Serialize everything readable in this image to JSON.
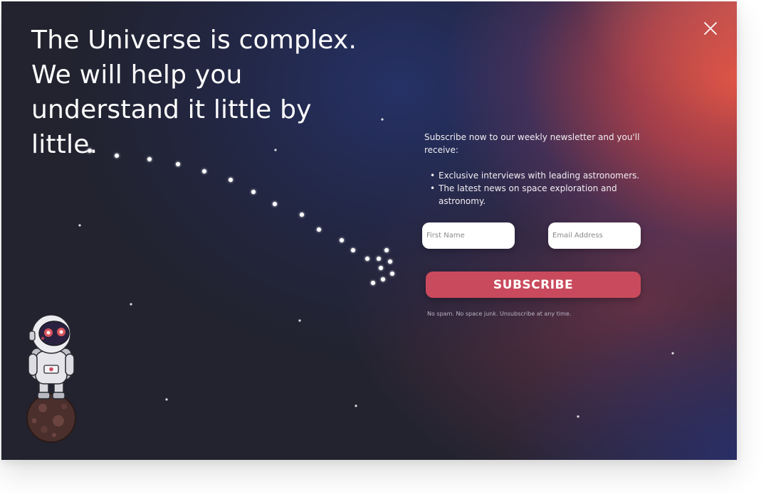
{
  "headline": {
    "text": "The Universe is complex. We will help you understand it little by little."
  },
  "close_button": {
    "icon": "close-icon"
  },
  "newsletter": {
    "intro": "Subscribe now to our weekly newsletter and you'll receive:",
    "benefits": [
      "Exclusive interviews with leading astronomers.",
      "The latest news on space exploration and astronomy."
    ],
    "bullet": "•",
    "first_name_placeholder": "First Name",
    "email_placeholder": "Email Address",
    "first_name_value": "",
    "email_value": "",
    "subscribe_label": "SUBSCRIBE",
    "fineprint": "No spam. No space junk. Unsubscribe at any time."
  },
  "illustration": {
    "icon": "astronaut-icon",
    "planet_icon": "planet-icon"
  },
  "colors": {
    "button": "#c94a5c",
    "background_dark": "#22232f",
    "accent_red": "#e05545",
    "accent_blue": "#263269",
    "text": "#ffffff"
  }
}
